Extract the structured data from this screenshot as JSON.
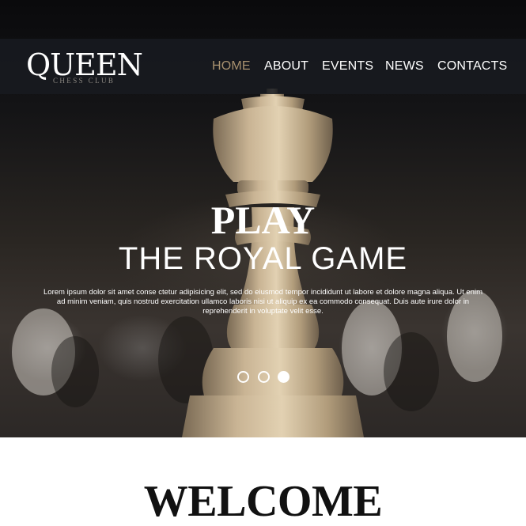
{
  "logo": {
    "main": "QUEEN",
    "sub": "CHESS CLUB"
  },
  "nav": {
    "items": [
      {
        "label": "HOME",
        "active": true
      },
      {
        "label": "ABOUT",
        "active": false
      },
      {
        "label": "EVENTS",
        "active": false
      },
      {
        "label": "NEWS",
        "active": false
      },
      {
        "label": "CONTACTS",
        "active": false
      }
    ]
  },
  "hero": {
    "title": "PLAY",
    "subtitle": "THE ROYAL GAME",
    "text": "Lorem ipsum dolor sit amet conse ctetur adipisicing elit, sed do eiusmod tempor incididunt ut labore et dolore magna aliqua. Ut enim ad minim veniam, quis nostrud exercitation ullamco laboris nisi ut aliquip ex ea commodo consequat. Duis aute irure dolor in reprehenderit in voluptate velit esse.",
    "slides": {
      "count": 3,
      "active": 3
    }
  },
  "welcome": {
    "title": "WELCOME"
  },
  "colors": {
    "accent": "#a8916f",
    "navbar": "#181a20",
    "text_light": "#ffffff",
    "text_dark": "#111111"
  }
}
